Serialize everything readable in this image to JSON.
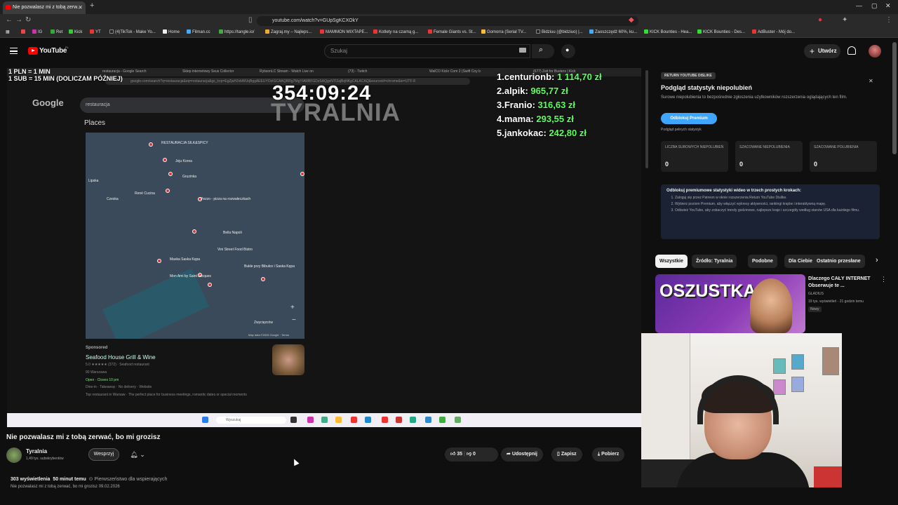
{
  "browser": {
    "tab_title": "Nie pozwalasz mi z tobą zerw...",
    "url": "youtube.com/watch?v=GUpSgKCXOkY",
    "bookmarks": [
      "IG",
      "Ret",
      "Kick",
      "YT",
      "(4)TikTok - Make Yo...",
      "Home",
      "Filman.cc",
      "https://tangle.io/",
      "Zagraj.my – Najleps...",
      "MAMMON MIXTAPE...",
      "Kotlety na czarną g...",
      "Female Giants vs. St...",
      "Gomorra (Serial TV...",
      "Bidziuu (@bidziuo) |...",
      "Zaoszczędź 60%, ku...",
      "KICK Bounties - Hea...",
      "KICK Bounties - Des...",
      "AdBuster - Mój do..."
    ]
  },
  "youtube": {
    "logo_text": "YouTube",
    "logo_cc": "PL",
    "search_placeholder": "Szukaj",
    "create_label": "Utwórz"
  },
  "video": {
    "overlay_left": [
      "1 PLN = 1 MIN",
      "1 SUB = 15 MIN (DOLICZAM PÓŹNIEJ)"
    ],
    "timer": "354:09:24",
    "watermark": "TYRALNIA",
    "inner_tabs": [
      "restauracja - Google Search",
      "Sklep internetowy Seus Collector",
      "RybsonLC Stream - Watch Live on",
      "(73) - Twitch",
      "WalCO Kickr Com 2 (Swift Coy b",
      "(677) Zeit for Busters | Kick"
    ],
    "inner_url": "google.com/search?q=restauracja&oq=restauracja&gs_lcrp=EgZjaHJvbWUqBggAEEUYOzIGCAAQRRg7MgYIARBFGDzSAQgxNTI2ajBqNKgCALACAQ&sourceid=chrome&ie=UTF-8",
    "google_logo": "Google",
    "google_query": "restauracja",
    "places_label": "Places",
    "leaderboard": [
      {
        "name": "1.centurionb:",
        "amount": "1 114,70 zł"
      },
      {
        "name": "2.alpik:",
        "amount": "965,77 zł"
      },
      {
        "name": "3.Franio:",
        "amount": "316,63 zł"
      },
      {
        "name": "4.mama:",
        "amount": "293,55 zł"
      },
      {
        "name": "5.jankokac:",
        "amount": "242,80 zł"
      }
    ],
    "map_labels": [
      "RESTAURACJA SILK&SPICY",
      "Jeju Korea",
      "Gruzinka",
      "René Cucina",
      "Pezzo - pizza na rozwałeczkach",
      "Bella Napoli",
      "Vini Street Food Bistro",
      "Maska Saska Kępa",
      "Mon Ami by Saint Jacques",
      "Bukłe przy Bibułce i Saska Kępa",
      "Czeska",
      "Lipska",
      "Zwycięzców"
    ],
    "map_footer": "Map data ©2026 Google · Terms",
    "sponsored": "Sponsored",
    "restaurant_name": "Seafood House Grill & Wine",
    "restaurant_lines": [
      "5.0 ★★★★★ (372) · Seafood restaurant",
      "90 Warszawa",
      "Open · Closes 10 pm",
      "Dine-in · Takeaway · No delivery · Website",
      "Top restaurant in Warsaw · The perfect place for business meetings, romantic dates or special moments"
    ],
    "taskbar_search": "Wyszukaj"
  },
  "watch": {
    "title": "Nie pozwalasz mi z tobą zerwać, bo mi grozisz",
    "channel": "Tyralnia",
    "subs": "1,49 tys. subskrybentów",
    "support_label": "Wesprzyj",
    "likes": "35",
    "dislikes": "0",
    "share": "Udostępnij",
    "save": "Zapisz",
    "download": "Pobierz",
    "desc_views": "303 wyświetlenia",
    "desc_time": "50 minut temu",
    "desc_priority": "Pierwszeństwo dla wspierających",
    "desc_sub": "Nie pozwalasz mi z tobą zerwać, bo mi grozisz 09.02.2026"
  },
  "ryd": {
    "tag": "RETURN YOUTUBE DISLIKE",
    "title": "Podgląd statystyk niepolubień",
    "desc": "Surowe niepolubienia to bezpośrednie zgłoszenia użytkowników rozszerzenia oglądających ten film.",
    "button": "Odblokuj Premium",
    "sub": "Podgląd pełnych statystyk",
    "stats": [
      {
        "label": "LICZBA SUROWYCH NIEPOLUBIEŃ",
        "value": "0"
      },
      {
        "label": "SZACOWANE NIEPOLUBIENIA",
        "value": "0"
      },
      {
        "label": "SZACOWANE POLUBIENIA",
        "value": "0"
      }
    ],
    "steps_title": "Odblokuj premiumowe statystyki wideo w trzech prostych krokach:",
    "steps": [
      "Zaloguj się przez Patreon w oknie rozszerzenia Return YouTube Dislike.",
      "Wybierz poziom Premium, aby włączyć wykresy aktywności, rankingi krajów i interaktywną mapę.",
      "Odśwież YouTube, aby zobaczyć trendy godzinowe, najlepsze kraje i szczegóły według stanów USA dla każdego filmu."
    ]
  },
  "chips": [
    "Wszystkie",
    "Źródło: Tyralnia",
    "Podobne",
    "Dla Ciebie",
    "Ostatnio przesłane"
  ],
  "related": {
    "thumb_text": "OSZUSTKA",
    "title": "Dlaczego CAŁY INTERNET Obserwuje te ...",
    "channel": "GLADIUS",
    "meta": "19 tys. wyświetleń · 21 godzin temu",
    "badge": "Nowy"
  }
}
